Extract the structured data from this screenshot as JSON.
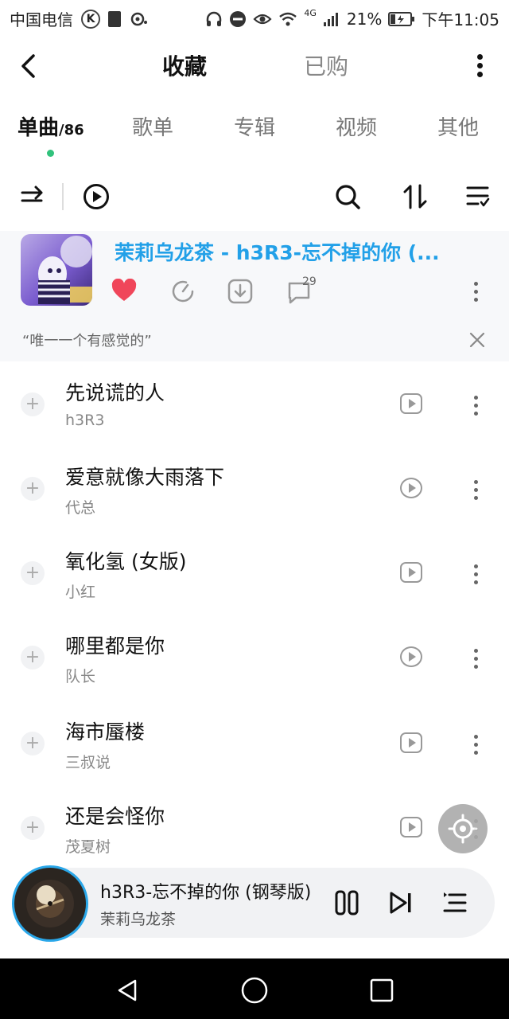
{
  "status_bar": {
    "carrier": "中国电信",
    "k_badge": "K",
    "network": "4G",
    "battery": "21%",
    "time": "下午11:05"
  },
  "header": {
    "back_icon": "chevron-left-icon",
    "title": "收藏",
    "purchased_tab": "已购",
    "more_icon": "vertical-dots-icon"
  },
  "tabs": [
    {
      "label": "单曲",
      "count": "/86",
      "active": true
    },
    {
      "label": "歌单"
    },
    {
      "label": "专辑"
    },
    {
      "label": "视频"
    },
    {
      "label": "其他"
    }
  ],
  "toolbar": {
    "icons": [
      "shuffle-icon",
      "play-icon",
      "search-icon",
      "sort-icon",
      "filter-list-icon"
    ]
  },
  "featured": {
    "title": "茉莉乌龙茶 - h3R3-忘不掉的你 (...",
    "comment_count": "29",
    "quote": "“唯一一个有感觉的”",
    "accent": "#22a0e8",
    "heart_color": "#f0465a"
  },
  "songs": [
    {
      "title": "先说谎的人",
      "artist": "h3R3"
    },
    {
      "title": "爱意就像大雨落下",
      "artist": "代总"
    },
    {
      "title": "氧化氢 (女版)",
      "artist": "小红"
    },
    {
      "title": "哪里都是你",
      "artist": "队长"
    },
    {
      "title": "海市蜃楼",
      "artist": "三叔说"
    },
    {
      "title": "还是会怪你",
      "artist": "茂夏树"
    }
  ],
  "player": {
    "title": "h3R3-忘不掉的你 (钢琴版)",
    "artist": "茉莉乌龙茶",
    "accent": "#2aa7e9"
  }
}
